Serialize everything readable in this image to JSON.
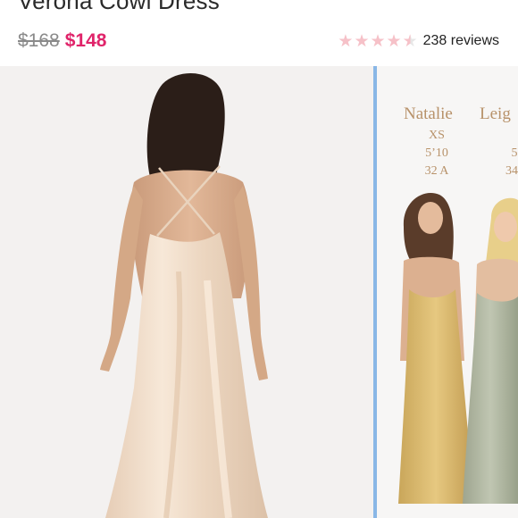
{
  "product": {
    "title": "Verona Cowl Dress",
    "old_price": "$168",
    "new_price": "$148",
    "rating_value": 4.5,
    "rating_max": 5,
    "reviews": "238 reviews"
  },
  "colors": {
    "sale": "#e0246a",
    "star": "#f6c1c8",
    "divider": "#89b7e6",
    "model_text": "#b8926a"
  },
  "models": [
    {
      "name": "Natalie",
      "size": "XS",
      "height": "5’10",
      "bra": "32 A"
    },
    {
      "name": "Leig",
      "size": "",
      "height": "5",
      "bra": "34"
    }
  ]
}
